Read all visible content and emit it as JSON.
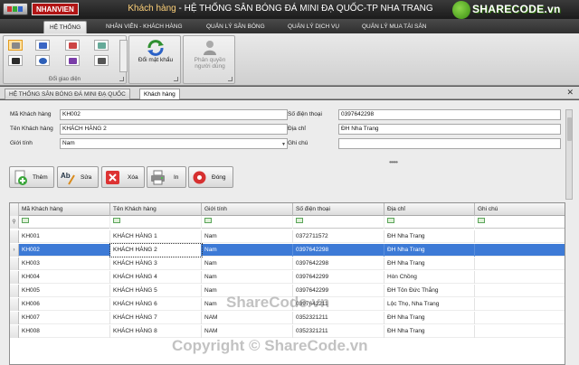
{
  "window": {
    "brand_badge": "NHANVIEN",
    "title_part1": "Khách hàng",
    "title_part2": " - HỆ THỐNG SÂN BÓNG ĐÁ MINI ĐẠ QUỐC-TP NHA TRANG"
  },
  "logo": {
    "text": "SHARECODE.vn"
  },
  "ribbon": {
    "tabs": [
      "HỆ THỐNG",
      "NHÂN VIÊN - KHÁCH HÀNG",
      "QUẢN LÝ SÂN BÓNG",
      "QUẢN LÝ DỊCH VỤ",
      "QUẢN LÝ MUA TÀI SẢN"
    ],
    "group_theme_label": "Đổi giao diện",
    "change_password_label": "Đổi mật khẩu",
    "user_permission_label_line1": "Phân quyền",
    "user_permission_label_line2": "người dùng"
  },
  "doc_tabs": [
    "HỆ THỐNG SÂN BÓNG ĐÁ MINI ĐẠ QUỐC",
    "Khách hàng"
  ],
  "form": {
    "customer_code_label": "Mã Khách hàng",
    "customer_code_value": "KH002",
    "customer_name_label": "Tên Khách hàng",
    "customer_name_value": "KHÁCH HÀNG 2",
    "gender_label": "Giới tính",
    "gender_value": "Nam",
    "phone_label": "Số điện thoại",
    "phone_value": "0397642298",
    "address_label": "Địa chỉ",
    "address_value": "ĐH Nha Trang",
    "note_label": "Ghi chú",
    "note_value": ""
  },
  "toolbar": {
    "add_label": "Thêm",
    "edit_label": "Sửa",
    "delete_label": "Xóa",
    "print_label": "In",
    "close_label": "Đóng"
  },
  "grid": {
    "columns": [
      "Mã Khách hàng",
      "Tên Khách hàng",
      "Giới tính",
      "Số điện thoại",
      "Địa chỉ",
      "Ghi chú"
    ],
    "rows": [
      [
        "KH001",
        "KHÁCH HÀNG 1",
        "Nam",
        "0372711572",
        "ĐH Nha Trang",
        ""
      ],
      [
        "KH002",
        "KHÁCH HÀNG 2",
        "Nam",
        "0397642298",
        "ĐH Nha Trang",
        ""
      ],
      [
        "KH003",
        "KHÁCH HÀNG 3",
        "Nam",
        "0397642298",
        "ĐH Nha Trang",
        ""
      ],
      [
        "KH004",
        "KHÁCH HÀNG 4",
        "Nam",
        "0397642299",
        "Hòn Chồng",
        ""
      ],
      [
        "KH005",
        "KHÁCH HÀNG 5",
        "Nam",
        "0397642299",
        "ĐH Tôn Đức Thắng",
        ""
      ],
      [
        "KH006",
        "KHÁCH HÀNG 6",
        "Nam",
        "0397642211",
        "Lộc Thọ, Nha Trang",
        ""
      ],
      [
        "KH007",
        "KHÁCH HÀNG 7",
        "NAM",
        "0352321211",
        "ĐH Nha Trang",
        ""
      ],
      [
        "KH008",
        "KHÁCH HÀNG 8",
        "NAM",
        "0352321211",
        "ĐH Nha Trang",
        ""
      ]
    ],
    "selected_row": 1
  },
  "watermarks": {
    "center": "ShareCode.vn",
    "bottom": "Copyright © ShareCode.vn"
  },
  "colors": {
    "selection": "#3d7ad6",
    "brand_badge": "#b11414",
    "title_highlight": "#ffd27a"
  }
}
